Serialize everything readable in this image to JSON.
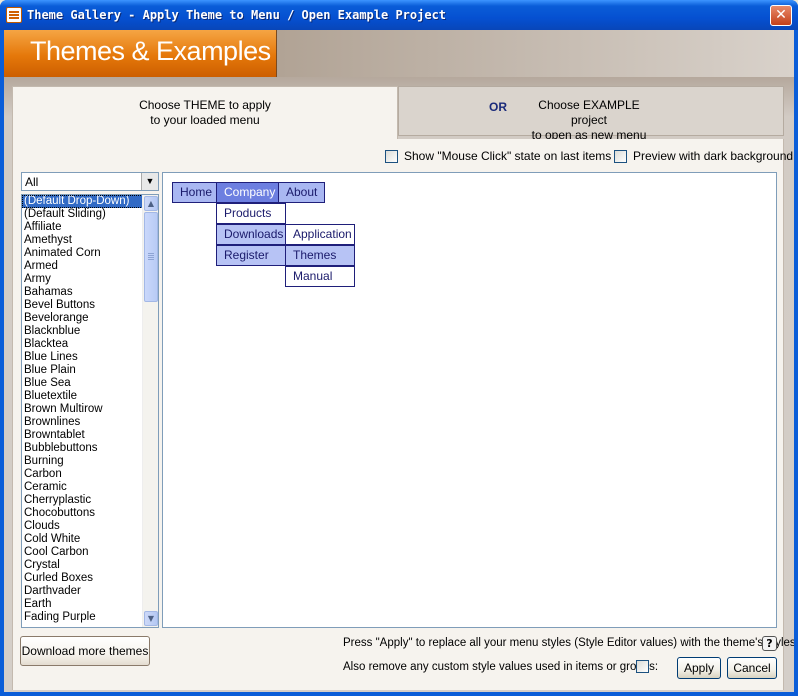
{
  "window": {
    "title": "Theme Gallery - Apply Theme to Menu / Open Example Project",
    "close_glyph": "✕"
  },
  "banner": {
    "title": "Themes & Examples"
  },
  "tabs": {
    "theme": {
      "line1": "Choose THEME to apply",
      "line2": "to your loaded menu"
    },
    "or_label": "OR",
    "example": {
      "line1": "Choose EXAMPLE project",
      "line2": "to open as new menu"
    }
  },
  "options": {
    "mouse_click_label": "Show \"Mouse Click\" state on last items",
    "mouse_click_checked": false,
    "dark_bg_label": "Preview with dark background",
    "dark_bg_checked": false
  },
  "filter": {
    "selected": "All"
  },
  "themes": {
    "selected_index": 0,
    "items": [
      "(Default Drop-Down)",
      "(Default Sliding)",
      "Affiliate",
      "Amethyst",
      "Animated Corn",
      "Armed",
      "Army",
      "Bahamas",
      "Bevel Buttons",
      "Bevelorange",
      "Blacknblue",
      "Blacktea",
      "Blue Lines",
      "Blue Plain",
      "Blue Sea",
      "Bluetextile",
      "Brown Multirow",
      "Brownlines",
      "Browntablet",
      "Bubblebuttons",
      "Burning",
      "Carbon",
      "Ceramic",
      "Cherryplastic",
      "Chocobuttons",
      "Clouds",
      "Cold White",
      "Cool Carbon",
      "Crystal",
      "Curled Boxes",
      "Darthvader",
      "Earth",
      "Fading Purple"
    ]
  },
  "preview_menu": {
    "top": [
      "Home",
      "Company",
      "About"
    ],
    "company_sub": [
      "Products",
      "Downloads",
      "Register"
    ],
    "downloads_sub": [
      "Application",
      "Themes",
      "Manual"
    ]
  },
  "footer": {
    "download_label": "Download more themes",
    "apply_note": "Press \"Apply\" to replace all your menu styles (Style Editor values) with the theme's styles.",
    "help_glyph": "?",
    "remove_custom_label": "Also remove any custom style values used in items or groups:",
    "remove_custom_checked": false,
    "apply_label": "Apply",
    "cancel_label": "Cancel"
  }
}
